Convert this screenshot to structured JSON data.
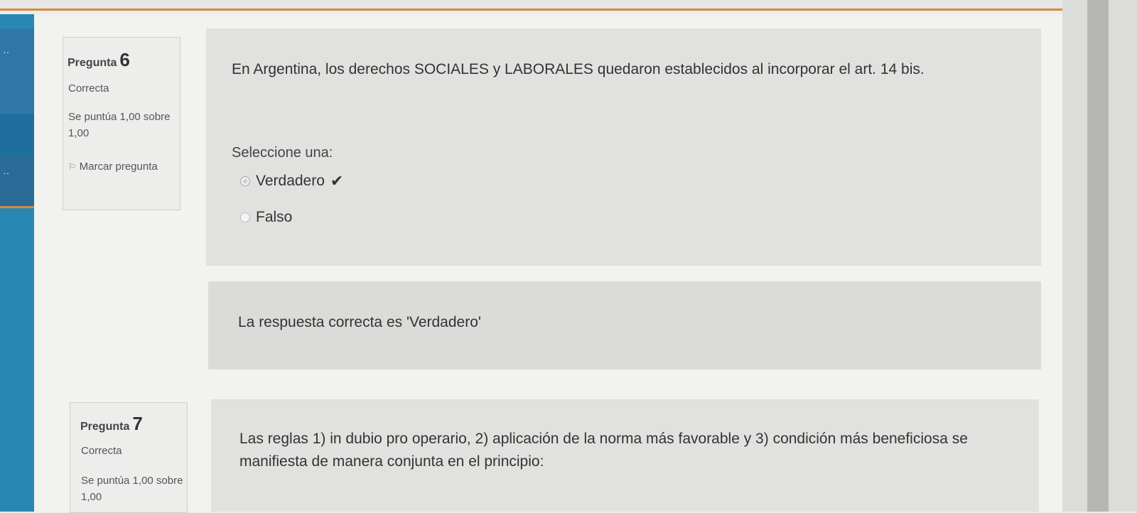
{
  "questions": [
    {
      "label": "Pregunta",
      "number": "6",
      "state": "Correcta",
      "score": "Se puntúa 1,00 sobre 1,00",
      "flag_label": "Marcar pregunta",
      "text": "En Argentina, los derechos SOCIALES y LABORALES quedaron establecidos al incorporar el art. 14 bis.",
      "prompt": "Seleccione una:",
      "answers": [
        {
          "label": "Verdadero",
          "selected": true,
          "correct": true
        },
        {
          "label": "Falso",
          "selected": false,
          "correct": false
        }
      ],
      "feedback": "La respuesta correcta es 'Verdadero'"
    },
    {
      "label": "Pregunta",
      "number": "7",
      "state": "Correcta",
      "score": "Se puntúa 1,00 sobre 1,00",
      "text": "Las reglas 1) in dubio pro operario, 2) aplicación de la norma más favorable y 3) condición más beneficiosa se manifiesta de manera conjunta en el principio:"
    }
  ],
  "icons": {
    "flag": "flag-icon",
    "check": "checkmark-icon"
  },
  "colors": {
    "accent": "#d98a3a",
    "rail": "#2a87b4"
  }
}
